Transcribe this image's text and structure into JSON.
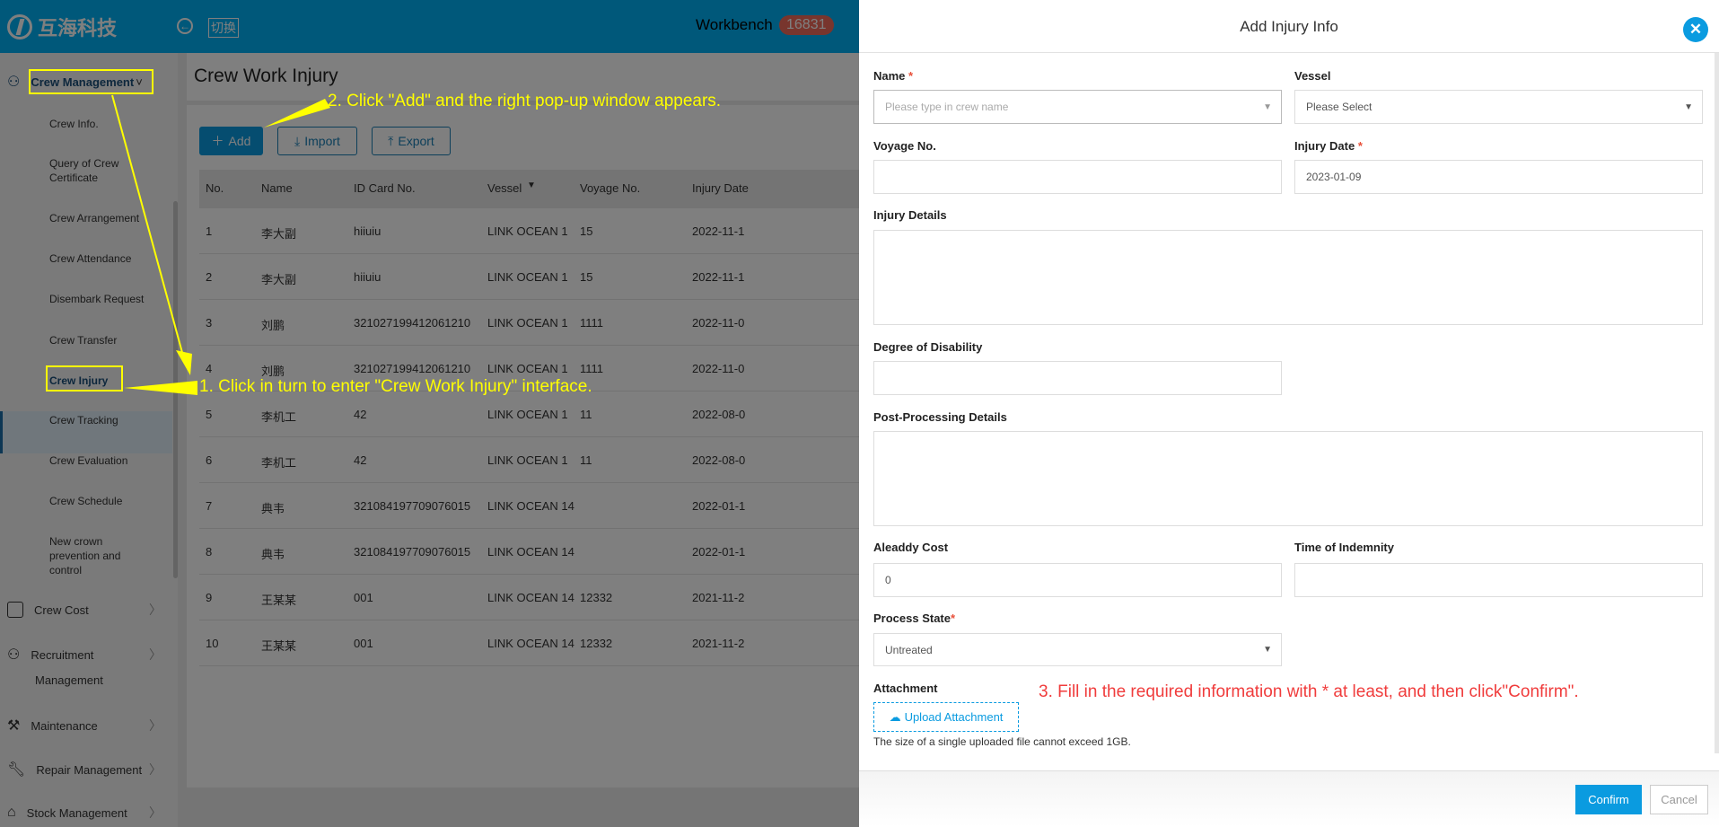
{
  "header": {
    "logo_text": "互海科技",
    "switch_label": "切换",
    "workbench_label": "Workbench",
    "workbench_count": "16831"
  },
  "sidebar": {
    "group_active": "Crew Management",
    "items": [
      "Crew Info.",
      "Query of Crew Certificate",
      "Crew Arrangement",
      "Crew Attendance",
      "Disembark Request",
      "Crew Transfer",
      "Crew Injury",
      "Crew Tracking",
      "Crew Evaluation",
      "Crew Schedule",
      "New crown prevention and control"
    ],
    "groups": [
      {
        "label": "Crew Cost",
        "icon": "wallet-icon"
      },
      {
        "label": "Recruitment",
        "label2": "Management",
        "icon": "user-add-icon"
      },
      {
        "label": "Maintenance",
        "icon": "hammer-icon"
      },
      {
        "label": "Repair Management",
        "icon": "wrench-icon"
      },
      {
        "label": "Stock Management",
        "icon": "house-icon"
      }
    ]
  },
  "main": {
    "title": "Crew Work Injury",
    "buttons": {
      "add": "Add",
      "import": "Import",
      "export": "Export"
    },
    "columns": [
      "No.",
      "Name",
      "ID Card No.",
      "Vessel",
      "Voyage No.",
      "Injury Date"
    ],
    "rows": [
      [
        "1",
        "李大副",
        "hiiuiu",
        "LINK OCEAN 1",
        "15",
        "2022-11-1"
      ],
      [
        "2",
        "李大副",
        "hiiuiu",
        "LINK OCEAN 1",
        "15",
        "2022-11-1"
      ],
      [
        "3",
        "刘鹏",
        "321027199412061210",
        "LINK OCEAN 1",
        "1111",
        "2022-11-0"
      ],
      [
        "4",
        "刘鹏",
        "321027199412061210",
        "LINK OCEAN 1",
        "1111",
        "2022-11-0"
      ],
      [
        "5",
        "李机工",
        "42",
        "LINK OCEAN 1",
        "11",
        "2022-08-0"
      ],
      [
        "6",
        "李机工",
        "42",
        "LINK OCEAN 1",
        "11",
        "2022-08-0"
      ],
      [
        "7",
        "典韦",
        "321084197709076015",
        "LINK OCEAN 14",
        "",
        "2022-01-1"
      ],
      [
        "8",
        "典韦",
        "321084197709076015",
        "LINK OCEAN 14",
        "",
        "2022-01-1"
      ],
      [
        "9",
        "王某某",
        "001",
        "LINK OCEAN 14",
        "12332",
        "2021-11-2"
      ],
      [
        "10",
        "王某某",
        "001",
        "LINK OCEAN 14",
        "12332",
        "2021-11-2"
      ]
    ]
  },
  "drawer": {
    "title": "Add Injury Info",
    "fields": {
      "name_label": "Name",
      "name_placeholder": "Please type in crew name",
      "vessel_label": "Vessel",
      "vessel_value": "Please Select",
      "voyage_label": "Voyage No.",
      "voyage_value": "",
      "date_label": "Injury Date",
      "date_value": "2023-01-09",
      "details_label": "Injury Details",
      "disability_label": "Degree of Disability",
      "post_label": "Post-Processing Details",
      "cost_label": "Aleaddy Cost",
      "cost_value": "0",
      "indemnity_label": "Time of Indemnity",
      "state_label": "Process State",
      "state_value": "Untreated",
      "attachment_label": "Attachment",
      "upload_label": "Upload Attachment",
      "upload_note": "The size of a single uploaded file cannot exceed 1GB."
    },
    "required_mark": "*",
    "confirm": "Confirm",
    "cancel": "Cancel"
  },
  "annotations": {
    "step1": "1. Click in turn to enter \"Crew Work Injury\" interface.",
    "step2": "2. Click \"Add\" and the right pop-up window appears.",
    "step3": "3. Fill in the required information with * at least, and then click\"Confirm\".",
    "yellow": "#ffff00",
    "red": "#f03c3c"
  },
  "colors": {
    "accent": "#0a9be0"
  }
}
